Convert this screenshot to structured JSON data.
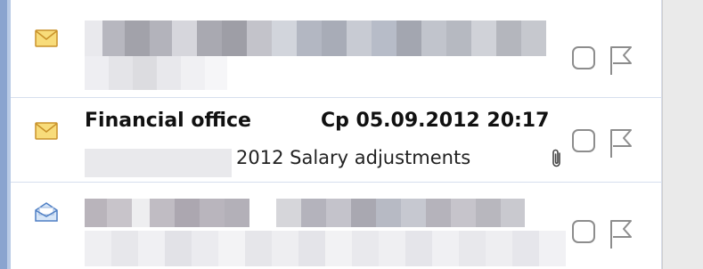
{
  "messages": [
    {
      "state": "unread",
      "icon": "closed-envelope-icon",
      "sender": "",
      "received": "",
      "subject": "",
      "redacted": true
    },
    {
      "state": "unread",
      "icon": "closed-envelope-icon",
      "sender": "Financial office",
      "received": "Cp 05.09.2012 20:17",
      "subject": "2012 Salary adjustments",
      "has_attachment": true,
      "attachment_icon": "paperclip-icon"
    },
    {
      "state": "read",
      "icon": "open-envelope-icon",
      "sender": "",
      "received": "",
      "subject": "",
      "redacted": true
    }
  ],
  "colors": {
    "unread_envelope": "#f2c44a",
    "read_envelope": "#6f9ad6",
    "selection_border": "#8aa4cf",
    "row_divider": "#d6dfee"
  }
}
